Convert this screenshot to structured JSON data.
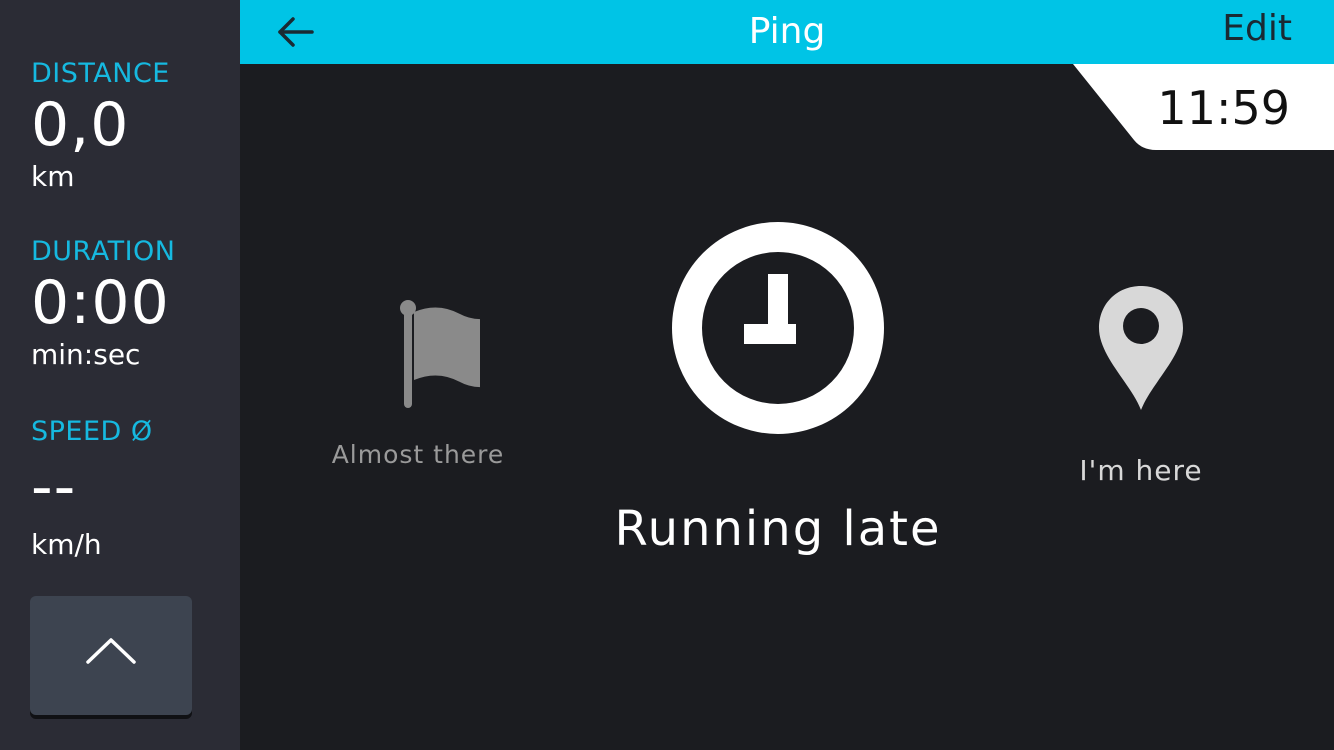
{
  "header": {
    "title": "Ping",
    "edit_label": "Edit",
    "color": "#00c4e6"
  },
  "clock": {
    "time": "11:59"
  },
  "sidebar": {
    "distance": {
      "label": "DISTANCE",
      "value": "0,0",
      "unit": "km"
    },
    "duration": {
      "label": "DURATION",
      "value": "0:00",
      "unit": "min:sec"
    },
    "speed": {
      "label": "SPEED Ø",
      "value": "--",
      "unit": "km/h"
    },
    "accent_color": "#16b9e0"
  },
  "options": {
    "almost_there": {
      "label": "Almost there",
      "icon": "flag-icon"
    },
    "running_late": {
      "label": "Running late",
      "icon": "clock-icon",
      "selected": true
    },
    "im_here": {
      "label": "I'm here",
      "icon": "location-pin-icon"
    }
  }
}
